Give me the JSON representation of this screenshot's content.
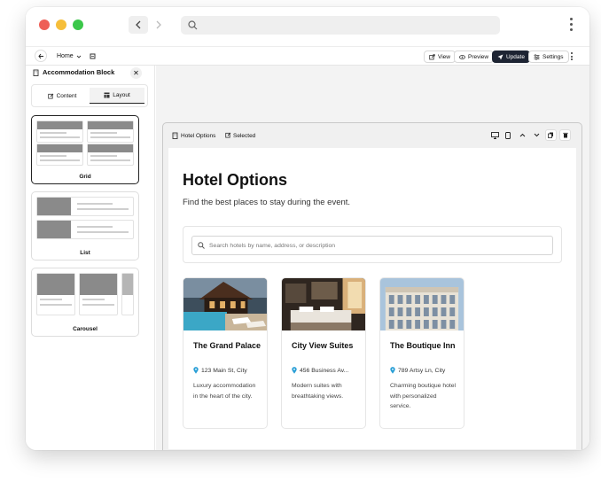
{
  "window": {
    "colors": {
      "close": "#ee5f57",
      "minimize": "#f6be3a",
      "maximize": "#3bc74a"
    }
  },
  "topbar": {
    "page_select": "Home",
    "view": "View",
    "preview": "Preview",
    "update": "Update",
    "settings": "Settings"
  },
  "panel": {
    "title": "Accommodation Block",
    "tabs": [
      {
        "label": "Content"
      },
      {
        "label": "Layout"
      }
    ],
    "layouts": [
      {
        "label": "Grid"
      },
      {
        "label": "List"
      },
      {
        "label": "Carousel"
      }
    ]
  },
  "canvas": {
    "block_name": "Hotel Options",
    "selected_label": "Selected",
    "heading": "Hotel Options",
    "subheading": "Find the best places to stay during the event.",
    "search_placeholder": "Search hotels by name, address, or description",
    "hotels": [
      {
        "name": "The Grand Palace",
        "address": "123 Main St, City",
        "description": "Luxury accommodation in the heart of the city."
      },
      {
        "name": "City View Suites",
        "address": "456 Business Av...",
        "description": "Modern suites with breathtaking views."
      },
      {
        "name": "The Boutique Inn",
        "address": "789 Artsy Ln, City",
        "description": "Charming boutique hotel with personalized service."
      }
    ]
  }
}
